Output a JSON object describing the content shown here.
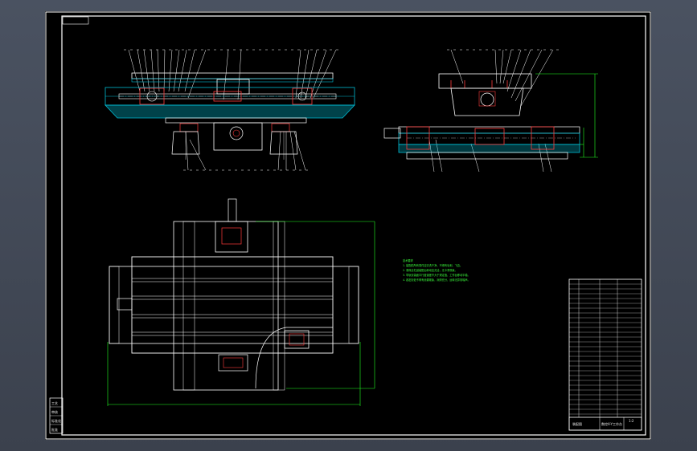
{
  "drawing": {
    "colors": {
      "background": "#000000",
      "frame": "#ffffff",
      "part": "#ffffff",
      "section": "#00bcd4",
      "hatch": "#ff3b3b",
      "dimension": "#22ff22"
    },
    "notes": {
      "heading": "技术要求",
      "lines": [
        "1. 装配前所有零件应清洗干净，不得有毛刺、飞边。",
        "2. 滚珠丝杠副装配后转动应灵活，无卡滞现象。",
        "3. 导轨安装面平行度误差不大于规定值，工作台移动平稳。",
        "4. 各密封处不得有渗漏现象，润滑充分，运转无异常噪声。"
      ]
    },
    "title_block": {
      "title": "数控X-Y工作台",
      "scale": "1:2",
      "sheet": "装配图"
    },
    "left_block": {
      "labels": [
        "工艺",
        "审核",
        "标准化",
        "批准"
      ]
    }
  }
}
